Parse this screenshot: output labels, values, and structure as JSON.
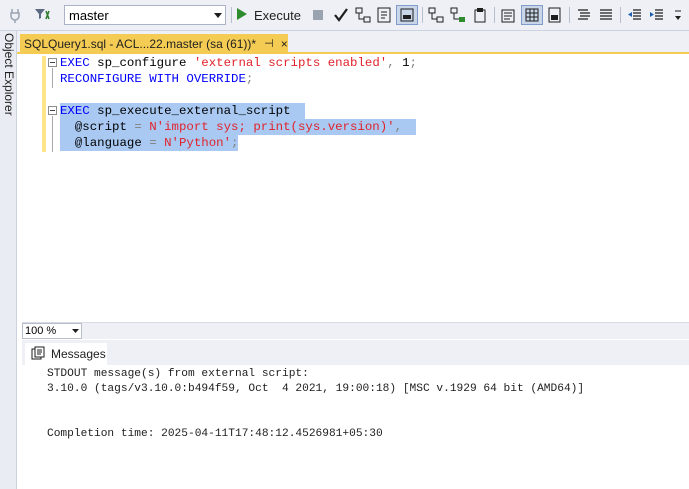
{
  "toolbar": {
    "database_select": {
      "value": "master"
    },
    "execute_label": "Execute"
  },
  "sidebar": {
    "object_explorer_label": "Object Explorer"
  },
  "document_tab": {
    "title": "SQLQuery1.sql - ACL...22.master (sa (61))*",
    "pin_glyph": "⊣",
    "close_glyph": "×"
  },
  "editor": {
    "lines": [
      {
        "tokens": [
          {
            "t": "EXEC",
            "c": "kw"
          },
          {
            "t": " sp_configure ",
            "c": "plain"
          },
          {
            "t": "'external scripts enabled'",
            "c": "str"
          },
          {
            "t": ", ",
            "c": "op"
          },
          {
            "t": "1",
            "c": "plain"
          },
          {
            "t": ";",
            "c": "op"
          }
        ]
      },
      {
        "tokens": [
          {
            "t": "RECONFIGURE WITH OVERRIDE",
            "c": "kw"
          },
          {
            "t": ";",
            "c": "op"
          }
        ]
      },
      {
        "tokens": []
      },
      {
        "tokens": [
          {
            "t": "EXEC",
            "c": "kw"
          },
          {
            "t": " sp_execute_external_script",
            "c": "plain"
          }
        ]
      },
      {
        "tokens": [
          {
            "t": "  @script ",
            "c": "plain"
          },
          {
            "t": "= ",
            "c": "op"
          },
          {
            "t": "N'import sys; print(sys.version)'",
            "c": "str"
          },
          {
            "t": ",",
            "c": "op"
          }
        ]
      },
      {
        "tokens": [
          {
            "t": "  @language ",
            "c": "plain"
          },
          {
            "t": "= ",
            "c": "op"
          },
          {
            "t": "N'Python'",
            "c": "str"
          },
          {
            "t": ";",
            "c": "op"
          }
        ]
      }
    ]
  },
  "zoom": {
    "value": "100 %"
  },
  "results": {
    "tab_label": "Messages",
    "lines": [
      "STDOUT message(s) from external script:",
      "3.10.0 (tags/v3.10.0:b494f59, Oct  4 2021, 19:00:18) [MSC v.1929 64 bit (AMD64)]",
      "",
      "",
      "Completion time: 2025-04-11T17:48:12.4526981+05:30"
    ]
  }
}
